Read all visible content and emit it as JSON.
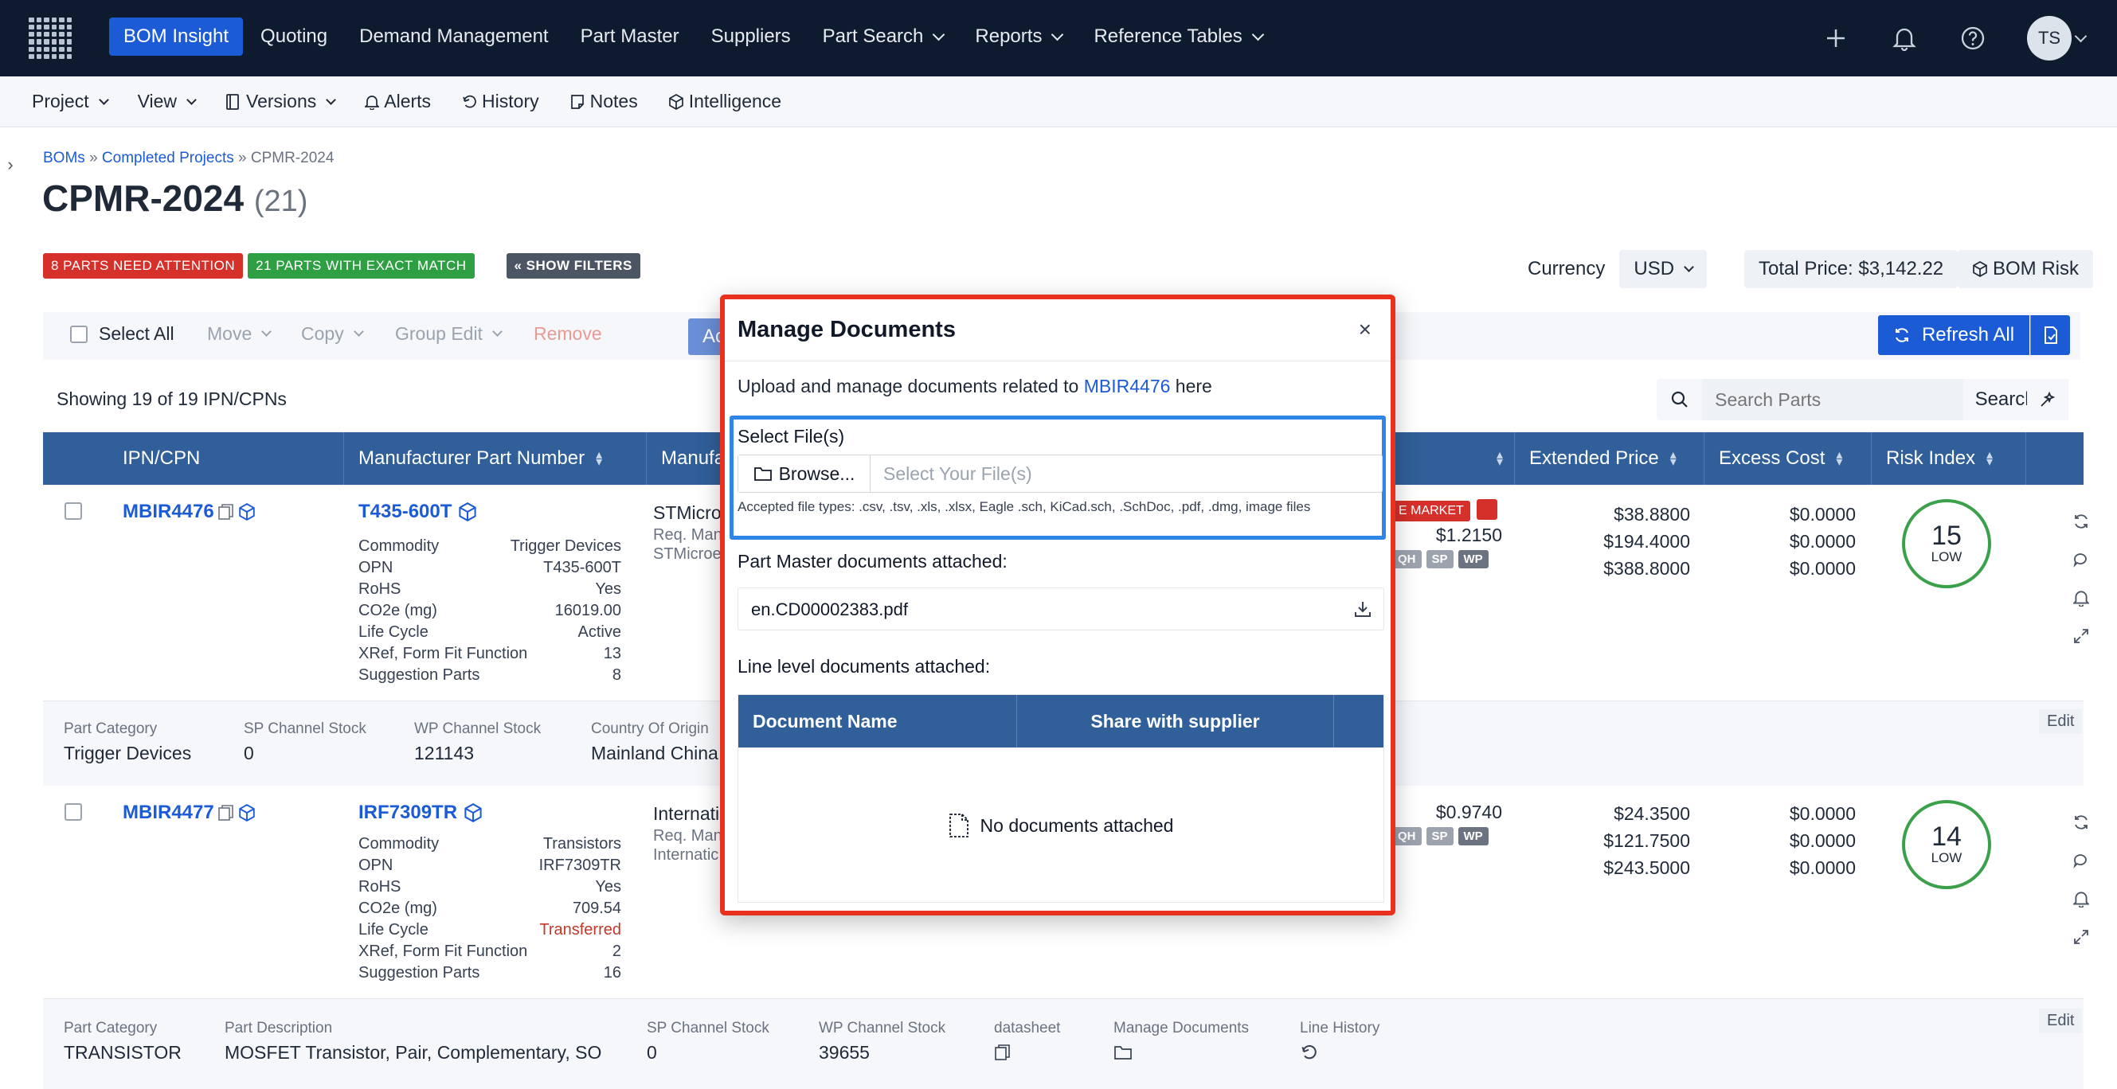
{
  "topnav": {
    "items": [
      "BOM Insight",
      "Quoting",
      "Demand Management",
      "Part Master",
      "Suppliers",
      "Part Search",
      "Reports",
      "Reference Tables"
    ],
    "user_initials": "TS"
  },
  "subbar": {
    "items": [
      "Project",
      "View",
      "Versions",
      "Alerts",
      "History",
      "Notes",
      "Intelligence"
    ]
  },
  "breadcrumb": {
    "boms": "BOMs",
    "sep1": "»",
    "completed": "Completed Projects",
    "sep2": "»",
    "current": "CPMR-2024"
  },
  "page": {
    "title": "CPMR-2024",
    "count": "(21)"
  },
  "badges": {
    "attention": "8 PARTS NEED ATTENTION",
    "exact": "21 PARTS WITH EXACT MATCH",
    "filters": "« SHOW FILTERS"
  },
  "currency": {
    "label": "Currency",
    "value": "USD"
  },
  "total_price": "Total Price: $3,142.22",
  "bom_risk": "BOM Risk",
  "actions": {
    "select_all": "Select All",
    "move": "Move",
    "copy": "Copy",
    "group_edit": "Group Edit",
    "remove": "Remove",
    "accept": "Accept",
    "refresh_all": "Refresh All"
  },
  "showing": "Showing 19 of 19 IPN/CPNs",
  "search": {
    "placeholder": "Search Parts",
    "button": "Search"
  },
  "table": {
    "headers": [
      "IPN/CPN",
      "Manufacturer Part Number",
      "Manufac",
      "Extended Price",
      "Excess Cost",
      "Risk Index"
    ]
  },
  "rows": [
    {
      "ipn": "MBIR4476",
      "mpn": "T435-600T",
      "commodity_label": "Commodity",
      "commodity": "Trigger Devices",
      "opn_label": "OPN",
      "opn": "T435-600T",
      "rohs_label": "RoHS",
      "rohs": "Yes",
      "co2_label": "CO2e (mg)",
      "co2": "16019.00",
      "lifecycle_label": "Life Cycle",
      "lifecycle": "Active",
      "xref_label": "XRef, Form Fit Function",
      "xref": "13",
      "sugg_label": "Suggestion Parts",
      "sugg": "8",
      "mfg": "STMicro",
      "req_man": "Req. Man",
      "mfg2": "STMicroe",
      "market": "E MARKET",
      "unit_price": "$1.2150",
      "ext_prices": [
        "$38.8800",
        "$194.4000",
        "$388.8000"
      ],
      "excess": [
        "$0.0000",
        "$0.0000",
        "$0.0000"
      ],
      "risk_num": "15",
      "risk_level": "LOW",
      "detail": {
        "part_category_label": "Part Category",
        "part_category": "Trigger Devices",
        "sp_label": "SP Channel Stock",
        "sp": "0",
        "wp_label": "WP Channel Stock",
        "wp": "121143",
        "origin_label": "Country Of Origin",
        "origin": "Mainland China"
      }
    },
    {
      "ipn": "MBIR4477",
      "mpn": "IRF7309TR",
      "commodity_label": "Commodity",
      "commodity": "Transistors",
      "opn_label": "OPN",
      "opn": "IRF7309TR",
      "rohs_label": "RoHS",
      "rohs": "Yes",
      "co2_label": "CO2e (mg)",
      "co2": "709.54",
      "lifecycle_label": "Life Cycle",
      "lifecycle": "Transferred",
      "xref_label": "XRef, Form Fit Function",
      "xref": "2",
      "sugg_label": "Suggestion Parts",
      "sugg": "16",
      "mfg": "Internati",
      "req_man": "Req. Man",
      "mfg2": "Internatic",
      "unit_price": "$0.9740",
      "ext_prices": [
        "$24.3500",
        "$121.7500",
        "$243.5000"
      ],
      "excess": [
        "$0.0000",
        "$0.0000",
        "$0.0000"
      ],
      "risk_num": "14",
      "risk_level": "LOW",
      "detail": {
        "part_category_label": "Part Category",
        "part_category": "TRANSISTOR",
        "desc_label": "Part Description",
        "desc": "MOSFET Transistor, Pair, Complementary, SO",
        "sp_label": "SP Channel Stock",
        "sp": "0",
        "wp_label": "WP Channel Stock",
        "wp": "39655",
        "datasheet_label": "datasheet",
        "manage_docs_label": "Manage Documents",
        "line_history_label": "Line History"
      }
    }
  ],
  "chips": {
    "qh": "QH",
    "sp": "SP",
    "wp": "WP"
  },
  "edit_label": "Edit",
  "modal": {
    "title": "Manage Documents",
    "close": "×",
    "desc_prefix": "Upload and manage documents related to",
    "desc_link": "MBIR4476",
    "desc_suffix": "here",
    "select_label": "Select File(s)",
    "browse": "Browse...",
    "placeholder": "Select Your File(s)",
    "accepted": "Accepted file types: .csv, .tsv, .xls, .xlsx, Eagle .sch, KiCad.sch, .SchDoc, .pdf, .dmg, image files",
    "pm_label": "Part Master documents attached:",
    "pm_file": "en.CD00002383.pdf",
    "ll_label": "Line level documents attached:",
    "th_name": "Document Name",
    "th_share": "Share with supplier",
    "no_docs": "No documents attached"
  },
  "colors": {
    "nav_bg": "#0e1b2e",
    "accent": "#1c5bd6",
    "header_bg": "#305f99",
    "modal_outline": "#e8321f",
    "focus": "#2f86e8"
  }
}
